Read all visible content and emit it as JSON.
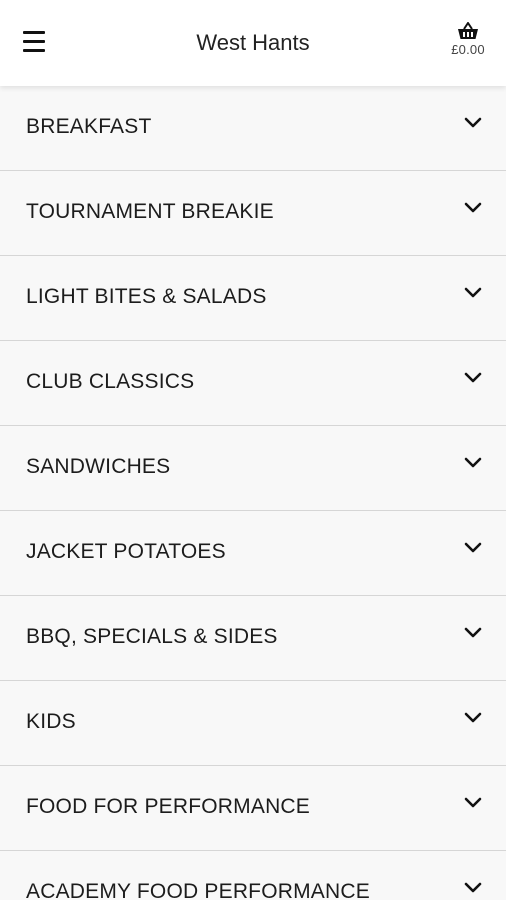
{
  "header": {
    "title": "West Hants",
    "menu_icon": "hamburger-menu-icon",
    "basket_icon": "basket-icon",
    "basket_total": "£0.00"
  },
  "categories": [
    {
      "label": "BREAKFAST"
    },
    {
      "label": "TOURNAMENT BREAKIE"
    },
    {
      "label": "LIGHT BITES & SALADS"
    },
    {
      "label": "CLUB CLASSICS"
    },
    {
      "label": "SANDWICHES"
    },
    {
      "label": "JACKET POTATOES"
    },
    {
      "label": "BBQ, SPECIALS & SIDES"
    },
    {
      "label": "KIDS"
    },
    {
      "label": "FOOD FOR PERFORMANCE"
    },
    {
      "label": "ACADEMY FOOD PERFORMANCE"
    }
  ],
  "category_chevron_icon": "chevron-down-icon"
}
